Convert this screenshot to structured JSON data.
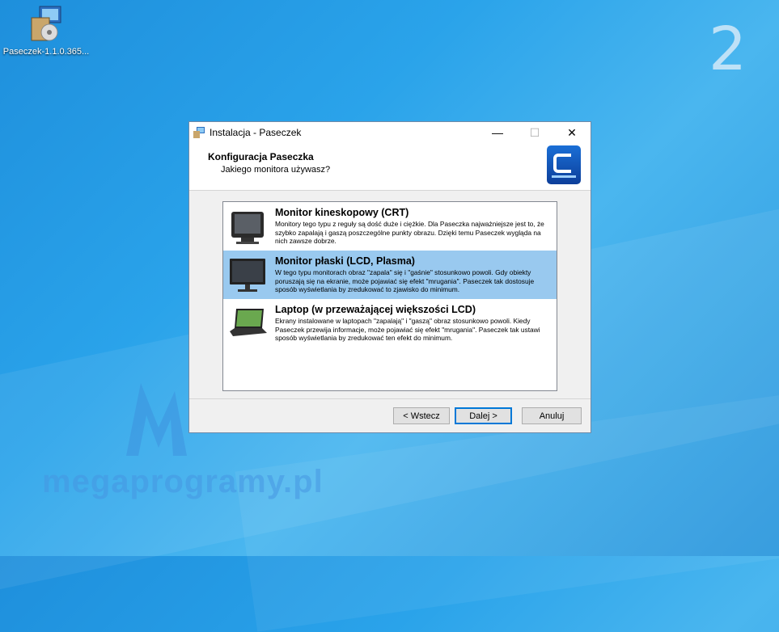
{
  "desktop": {
    "icon_label": "Paseczek-1.1.0.365...",
    "step_number": "2",
    "watermark": "megaprogramy.pl"
  },
  "window": {
    "title": "Instalacja - Paseczek",
    "controls": {
      "minimize": "—",
      "maximize": "☐",
      "close": "✕"
    }
  },
  "header": {
    "title": "Konfiguracja Paseczka",
    "subtitle": "Jakiego monitora używasz?"
  },
  "options": [
    {
      "title": "Monitor kineskopowy (CRT)",
      "description": "Monitory tego typu z reguły są dość duże i ciężkie. Dla Paseczka najważniejsze jest to, że szybko zapalają i gaszą poszczególne punkty obrazu. Dzięki temu Paseczek wygląda na nich zawsze dobrze.",
      "icon": "crt-monitor-icon",
      "selected": false
    },
    {
      "title": "Monitor płaski (LCD, Plasma)",
      "description": "W tego typu monitorach obraz \"zapala\" się i \"gaśnie\" stosunkowo powoli. Gdy obiekty poruszają się na ekranie, może pojawiać się efekt \"mrugania\". Paseczek tak dostosuje sposób wyświetlania by zredukować to zjawisko do minimum.",
      "icon": "flat-monitor-icon",
      "selected": true
    },
    {
      "title": "Laptop (w przeważającej większości LCD)",
      "description": "Ekrany instalowane w laptopach \"zapalają\" i \"gaszą\" obraz stosunkowo powoli. Kiedy Paseczek przewija informacje, może pojawiać się efekt \"mrugania\". Paseczek tak ustawi sposób wyświetlania by zredukować ten efekt do minimum.",
      "icon": "laptop-icon",
      "selected": false
    }
  ],
  "buttons": {
    "back": "< Wstecz",
    "next": "Dalej >",
    "cancel": "Anuluj"
  },
  "colors": {
    "selection": "#99c9ef",
    "accent": "#0078d7"
  }
}
